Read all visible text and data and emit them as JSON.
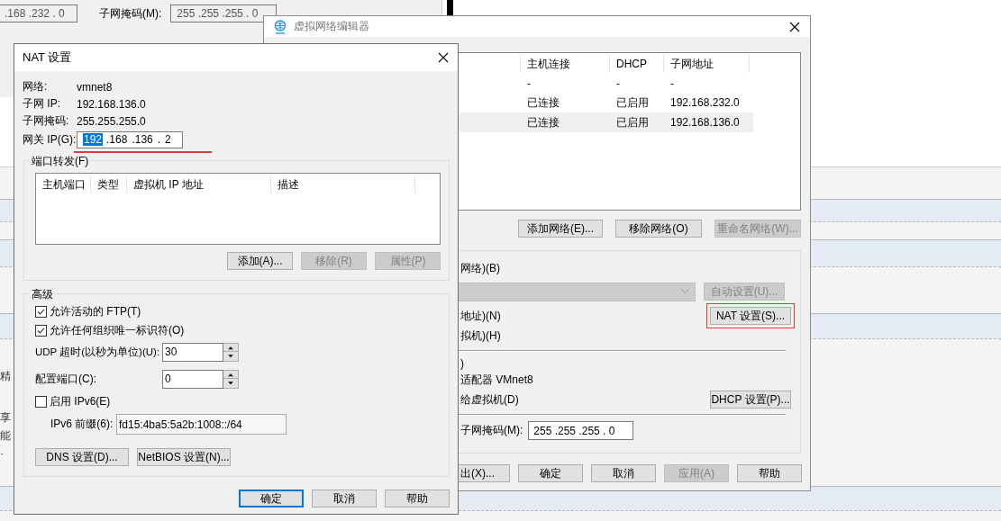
{
  "background_app": {
    "address_field": ".168 .232 . 0",
    "mask_label": "子网掩码(M):",
    "mask_field": "255 .255 .255 . 0",
    "page_fragments": [
      "精",
      "享",
      "能",
      "·"
    ]
  },
  "network_editor": {
    "title": "虚拟网络编辑器",
    "columns": [
      "主机连接",
      "DHCP",
      "子网地址"
    ],
    "rows": [
      {
        "cells": [
          "-",
          "-",
          "-"
        ],
        "selected": false
      },
      {
        "cells": [
          "已连接",
          "已启用",
          "192.168.232.0"
        ],
        "selected": false
      },
      {
        "cells": [
          "已连接",
          "已启用",
          "192.168.136.0"
        ],
        "selected": true
      }
    ],
    "list_buttons": [
      {
        "label": "添加网络(E)...",
        "disabled": false
      },
      {
        "label": "移除网络(O)",
        "disabled": false
      },
      {
        "label": "重命名网络(W)...",
        "disabled": true
      }
    ],
    "bridge_label": "网络)(B)",
    "auto_button": {
      "label": "自动设置(U)...",
      "disabled": true
    },
    "nat_label": "地址)(N)",
    "nat_button": {
      "label": "NAT 设置(S)...",
      "disabled": false
    },
    "host_only_label": "拟机)(H)",
    "connect_label": ")",
    "adapter_label": "适配器 VMnet8",
    "dhcp_label": "给虚拟机(D)",
    "dhcp_button": {
      "label": "DHCP 设置(P)...",
      "disabled": false
    },
    "mask_label": "子网掩码(M):",
    "mask_field": "255 .255 .255 . 0",
    "footer_buttons": [
      {
        "label": "出(X)...",
        "disabled": false
      },
      {
        "label": "确定",
        "disabled": false
      },
      {
        "label": "取消",
        "disabled": false
      },
      {
        "label": "应用(A)",
        "disabled": true
      },
      {
        "label": "帮助",
        "disabled": false
      }
    ]
  },
  "nat_dialog": {
    "title": "NAT 设置",
    "info": [
      {
        "label": "网络:",
        "value": "vmnet8"
      },
      {
        "label": "子网 IP:",
        "value": "192.168.136.0"
      },
      {
        "label": "子网掩码:",
        "value": "255.255.255.0"
      }
    ],
    "gateway_label": "网关 IP(G):",
    "gateway_parts": [
      {
        "text": "192",
        "selected": true
      },
      {
        "text": ".168",
        "selected": false
      },
      {
        "text": ".136",
        "selected": false
      },
      {
        "text": ".",
        "selected": false
      },
      {
        "text": "2",
        "selected": false
      }
    ],
    "port_forwarding": {
      "title": "端口转发(F)",
      "columns": [
        "主机端口",
        "类型",
        "虚拟机 IP 地址",
        "描述"
      ],
      "buttons": [
        {
          "label": "添加(A)...",
          "disabled": false
        },
        {
          "label": "移除(R)",
          "disabled": true
        },
        {
          "label": "属性(P)",
          "disabled": true
        }
      ]
    },
    "advanced": {
      "title": "高级",
      "checkboxes": [
        {
          "label": "允许活动的 FTP(T)",
          "checked": true
        },
        {
          "label": "允许任何组织唯一标识符(O)",
          "checked": true
        }
      ],
      "udp_label": "UDP 超时(以秒为单位)(U):",
      "udp_value": "30",
      "port_label": "配置端口(C):",
      "port_value": "0",
      "ipv6": {
        "label": "启用 IPv6(E)",
        "checked": false
      },
      "prefix_label": "IPv6 前缀(6):",
      "prefix_value": "fd15:4ba5:5a2b:1008::/64",
      "buttons": [
        {
          "label": "DNS 设置(D)...",
          "disabled": false
        },
        {
          "label": "NetBIOS 设置(N)...",
          "disabled": false
        }
      ]
    },
    "footer_buttons": [
      {
        "label": "确定",
        "default": true
      },
      {
        "label": "取消",
        "default": false
      },
      {
        "label": "帮助",
        "default": false
      }
    ]
  }
}
